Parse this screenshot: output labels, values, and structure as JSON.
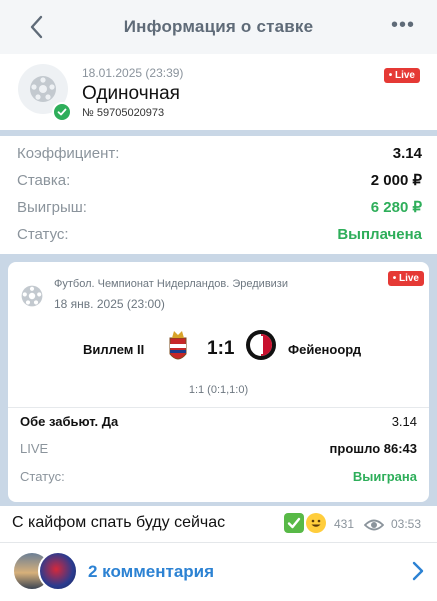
{
  "header": {
    "title": "Информация о ставке",
    "back_icon": "chevron-left-icon",
    "more_icon": "ellipsis-icon"
  },
  "bet": {
    "datetime": "18.01.2025 (23:39)",
    "type": "Одиночная",
    "number": "№ 59705020973",
    "live_badge": "• Live"
  },
  "summary": {
    "coef_label": "Коэффициент:",
    "coef_value": "3.14",
    "stake_label": "Ставка:",
    "stake_value": "2 000 ₽",
    "win_label": "Выигрыш:",
    "win_value": "6 280 ₽",
    "status_label": "Статус:",
    "status_value": "Выплачена"
  },
  "event": {
    "league": "Футбол. Чемпионат Нидерландов. Эредивизи",
    "date": "18 янв. 2025 (23:00)",
    "live_badge": "• Live",
    "home_team": "Виллем II",
    "away_team": "Фейеноорд",
    "score": "1:1",
    "halftime": "1:1 (0:1,1:0)",
    "market": "Обе забьют. Да",
    "market_coef": "3.14",
    "live_label": "LIVE",
    "elapsed": "прошло 86:43",
    "status_label": "Статус:",
    "status_value": "Выиграна"
  },
  "message": {
    "text": "С кайфом спать буду сейчас",
    "views": "431",
    "time": "03:53"
  },
  "comments": {
    "label": "2 комментария"
  },
  "colors": {
    "green": "#2eae5a",
    "live_red": "#e53935",
    "link_blue": "#2c82d3"
  }
}
